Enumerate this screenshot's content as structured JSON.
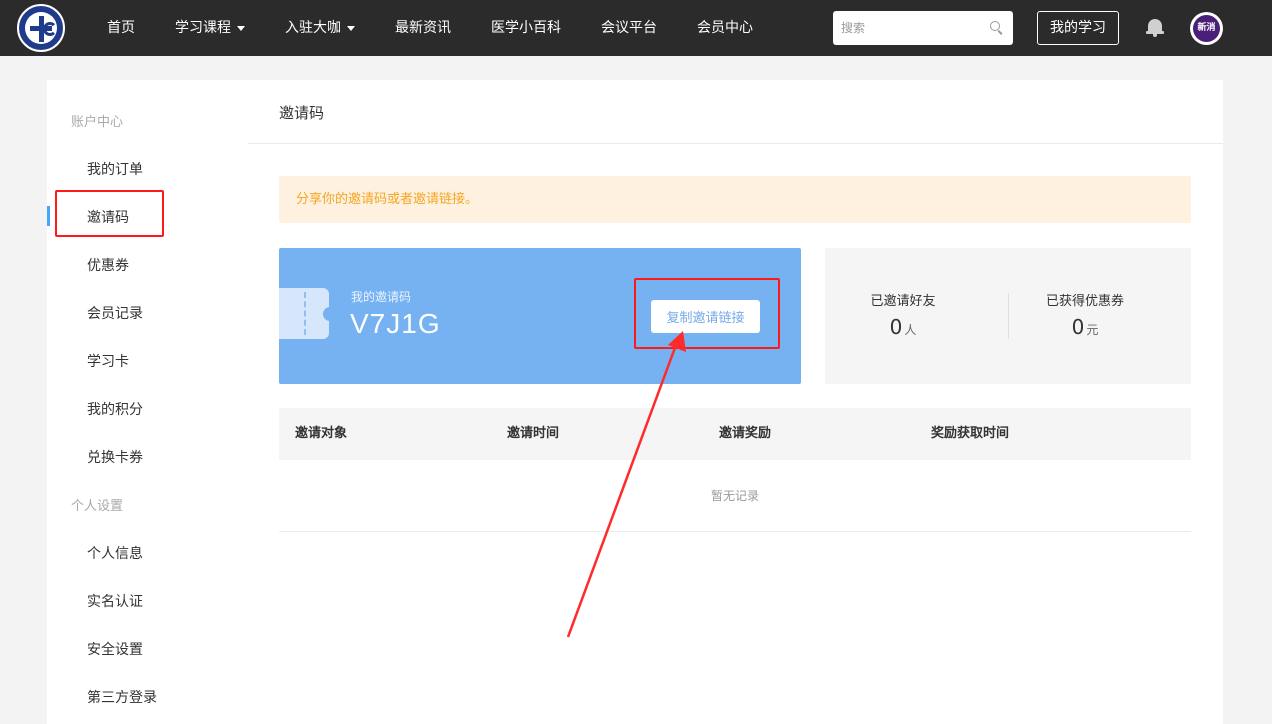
{
  "nav": {
    "items": [
      {
        "label": "首页",
        "dropdown": false
      },
      {
        "label": "学习课程",
        "dropdown": true
      },
      {
        "label": "入驻大咖",
        "dropdown": true
      },
      {
        "label": "最新资讯",
        "dropdown": false
      },
      {
        "label": "医学小百科",
        "dropdown": false
      },
      {
        "label": "会议平台",
        "dropdown": false
      },
      {
        "label": "会员中心",
        "dropdown": false
      }
    ],
    "search_placeholder": "搜索",
    "my_learning": "我的学习",
    "avatar_text": "新消"
  },
  "sidebar": {
    "group1": "账户中心",
    "items1": [
      {
        "label": "我的订单"
      },
      {
        "label": "邀请码",
        "active": true
      },
      {
        "label": "优惠券"
      },
      {
        "label": "会员记录"
      },
      {
        "label": "学习卡"
      },
      {
        "label": "我的积分"
      },
      {
        "label": "兑换卡券"
      }
    ],
    "group2": "个人设置",
    "items2": [
      {
        "label": "个人信息"
      },
      {
        "label": "实名认证"
      },
      {
        "label": "安全设置"
      },
      {
        "label": "第三方登录"
      }
    ]
  },
  "main": {
    "title": "邀请码",
    "notice": "分享你的邀请码或者邀请链接。",
    "code_label": "我的邀请码",
    "code_value": "V7J1G",
    "copy_button": "复制邀请链接",
    "stats": [
      {
        "label": "已邀请好友",
        "value": "0",
        "unit": "人"
      },
      {
        "label": "已获得优惠券",
        "value": "0",
        "unit": "元"
      }
    ],
    "table": {
      "headers": [
        "邀请对象",
        "邀请时间",
        "邀请奖励",
        "奖励获取时间"
      ],
      "empty_text": "暂无记录"
    }
  },
  "colors": {
    "nav_bg": "#2b2b2b",
    "card_blue": "#76b2f2",
    "notice_bg": "#fff1e0",
    "notice_text": "#f5a623",
    "annotation_red": "#ff1a1a"
  }
}
